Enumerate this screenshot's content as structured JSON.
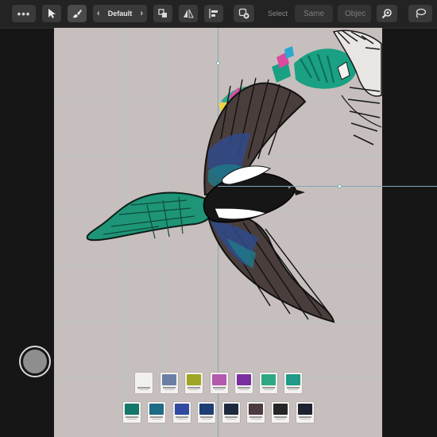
{
  "toolbar": {
    "more_label": "•••",
    "style_label": "Default",
    "prev_chevron": "‹",
    "next_chevron": "›",
    "select_label": "Select",
    "same_label": "Same",
    "object_label": "Objec"
  },
  "icons": {
    "move": "pointer-icon",
    "brush": "brush-icon",
    "arrange": "arrange-icon",
    "flip": "flip-icon",
    "align": "align-icon",
    "add_layer": "add-layer-icon",
    "zoom": "zoom-icon",
    "lasso": "lasso-icon"
  },
  "swatches_row1": [
    "#f2f0ed",
    "#6b7fa6",
    "#a0a524",
    "#b45aae",
    "#7a2fa0",
    "#2da883",
    "#1e9a86"
  ],
  "swatches_row2": [
    "#12786a",
    "#1f6a86",
    "#2f4aa0",
    "#1e3e74",
    "#1d2a3e",
    "#4b3a40",
    "#262626",
    "#1e2130"
  ],
  "colors": {
    "wing_brown": "#4a3e3c",
    "tail_teal": "#1e9577",
    "body_black": "#161616",
    "belly_white": "#ffffff",
    "canvas": "#c7bfbd"
  }
}
